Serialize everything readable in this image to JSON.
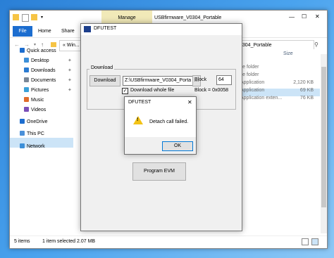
{
  "explorer": {
    "tab_manage": "Manage",
    "title": "USBfirmware_V0304_Portable",
    "ribbon": {
      "file": "File",
      "home": "Home",
      "share": "Share"
    },
    "address_short": "Win...",
    "address_right": "0304_Portable",
    "nav": [
      {
        "label": "Quick access",
        "icon": "star-icon"
      },
      {
        "label": "Desktop",
        "icon": "desktop-icon"
      },
      {
        "label": "Downloads",
        "icon": "download-icon"
      },
      {
        "label": "Documents",
        "icon": "documents-icon"
      },
      {
        "label": "Pictures",
        "icon": "pictures-icon"
      },
      {
        "label": "Music",
        "icon": "music-icon"
      },
      {
        "label": "Videos",
        "icon": "videos-icon"
      },
      {
        "label": "OneDrive",
        "icon": "cloud-icon"
      },
      {
        "label": "This PC",
        "icon": "computer-icon"
      },
      {
        "label": "Network",
        "icon": "network-icon"
      }
    ],
    "column_size": "Size",
    "rows": [
      {
        "type": "ile folder",
        "size": ""
      },
      {
        "type": "ile folder",
        "size": ""
      },
      {
        "type": "Application",
        "size": "2,120 KB"
      },
      {
        "type": "Application",
        "size": "69 KB"
      },
      {
        "type": "Application exten...",
        "size": "76 KB"
      }
    ],
    "status": {
      "items": "5 items",
      "selected": "1 item selected  2.07 MB"
    }
  },
  "dfu": {
    "title": "DFUTEST",
    "download_group": "Download",
    "download_button": "Download",
    "path": "Z:\\USBfirmware_V0304_Porta",
    "block_label": "Block",
    "block_value": "64",
    "download_whole_file": "Download whole file",
    "block_addr": "Block = 0x0058",
    "program_button": "Program EVM"
  },
  "dialog": {
    "title": "DFUTEST",
    "message": "Detach call failed.",
    "ok": "OK",
    "close": "✕"
  },
  "window_controls": {
    "minimize": "—",
    "maximize": "☐",
    "close": "✕"
  }
}
